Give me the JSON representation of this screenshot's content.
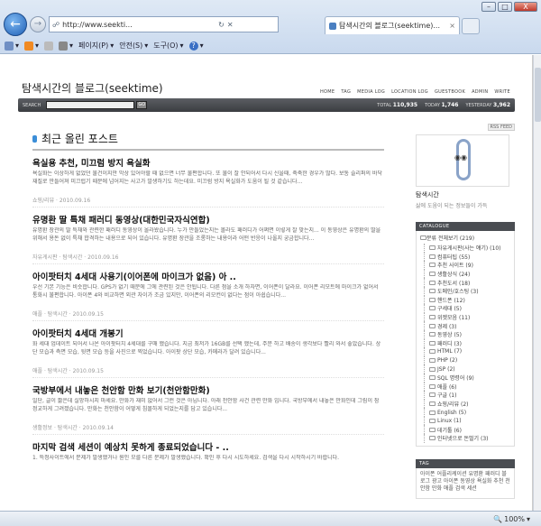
{
  "browser": {
    "address": "http://www.seekti...",
    "tab_title": "탐색시간의 블로그(seektime)...",
    "toolbar": {
      "page_label": "페이지(P)",
      "safety_label": "안전(S)",
      "tools_label": "도구(O)",
      "help_label": "?"
    },
    "window_buttons": {
      "minimize": "–",
      "restore": "□",
      "close": "X"
    },
    "zoom": "100%"
  },
  "blog": {
    "title": "탐색시간의 블로그(seektime)",
    "nav": [
      "HOME",
      "TAG",
      "MEDIA LOG",
      "LOCATION LOG",
      "GUESTBOOK",
      "ADMIN",
      "WRITE"
    ],
    "search_label": "SEARCH",
    "search_button": "GO",
    "stats": {
      "total_label": "TOTAL",
      "total": "110,935",
      "today_label": "TODAY",
      "today": "1,746",
      "yesterday_label": "YESTERDAY",
      "yesterday": "3,962"
    }
  },
  "main": {
    "heading": "최근 올린 포스트",
    "posts": [
      {
        "title": "욕실용 추천, 미끄럼 방지 욕실화",
        "body": "욕실화는 이상하게 없었던 물건이지만 막상 있어야할 때 없으면 너무 불편합니다. 또 불이 잘 안되어서 다시 신을때, 축축한 경우가 많다. 보통 슬리퍼의 바닥 재질로 만들어져 미끄럽기 때문에 넘어지는 사고가 발생하기도 하는데요. 미끄럼 방지 욕실화가 도움이 될 것 같습니다...",
        "meta": "쇼핑/리뷰 · 2010.09.16"
      },
      {
        "title": "유명환 딸 특채 패러디 동영상(대한민국자식연합)",
        "body": "유명환 장관의 딸 특채와 관련한 패러디 동영상이 올라왔습니다. 누가 만들었는지는 몰라도 패러디가 어쩌면 이렇게 잘 맞는지... 이 동영상은 유명환의 딸을 위해서 용돈 없이 특채 합격하는 내용으로 되어 있습니다. 유명환 장관을 조롱하는 내용이라 어떤 반응이 나올지 궁금합니다...",
        "meta": "자유게시판 · 탐색시간 · 2010.09.16"
      },
      {
        "title": "아이팟터치 4세대 사용기(이어폰에 마이크가 없음) 아 ..",
        "body": "우선 기본 기능은 비슷합니다. GPS가 없기 때문에 그에 관련된 것은 안됩니다. 다른 점을 소개 하자면, 이어폰이 달라요. 이어폰 리모트에 마이크가 없어서 통화시 불편합니다. 아이폰 4와 비교하면 외관 차이가 조금 있지만, 이어폰의 리모컨이 없다는 점이 아쉽습니다...",
        "meta": "애플 · 탐색시간 · 2010.09.15"
      },
      {
        "title": "아이팟터치 4세대 개봉기",
        "body": "화 세대 업데이트 되어서 나온 아이팟터치 4세대를 구매 했습니다. 지금 최저가 16GB를 선택 했는데, 주문 하고 배송이 생각보다 빨리 와서 좋았습니다. 상단 모습과 측면 모습, 뒷면 모습 등을 사진으로 찍었습니다. 아이팟 상단 모습, 카메라가 달려 있습니다...",
        "meta": "애플 · 탐색시간 · 2010.09.15"
      },
      {
        "title": "국방부에서 내놓은 천안함 만화 보기(천안함만화)",
        "body": "일단, 글이 짧은데 실망하시지 마세요. 만화가 재미 없어서 그런 것은 아닙니다. 아래 천안함 사건 관련 만화 입니다. 국방부에서 내놓은 만화인데 그림이 참 정교하게 그려졌습니다. 만화는 천안함이 어떻게 침몰하게 되었는지를 담고 있습니다...",
        "meta": "생활정보 · 탐색시간 · 2010.09.14"
      },
      {
        "title": "마지막 검색 세션이 예상치 못하게 종료되었습니다 - ..",
        "body": "1. 특정사이트에서 문제가 발생했거나 원인 모를 다른 문제가 발생했습니다. 확인 후 다시 시도하세요. 검색을 다시 시작하시기 바랍니다.",
        "meta": ""
      }
    ]
  },
  "sidebar": {
    "rss": "RSS FEED",
    "profile_name": "탐색시간",
    "profile_desc": "삶에 도움이 되는 정보들이 가득",
    "catalogue_head": "CATALOGUE",
    "categories": [
      {
        "label": "분류 전체보기 (219)"
      },
      {
        "label": "자유게시판(사는 얘기) (10)"
      },
      {
        "label": "컴퓨터팁 (55)"
      },
      {
        "label": "추천 사이트 (9)"
      },
      {
        "label": "생활상식 (24)"
      },
      {
        "label": "추천도서 (18)"
      },
      {
        "label": "도메인/호스팅 (3)"
      },
      {
        "label": "핸드폰 (12)"
      },
      {
        "label": "구세대 (5)"
      },
      {
        "label": "위젯모음 (11)"
      },
      {
        "label": "경제 (3)"
      },
      {
        "label": "동영상 (5)"
      },
      {
        "label": "패러디 (3)"
      },
      {
        "label": "HTML (7)"
      },
      {
        "label": "PHP (2)"
      },
      {
        "label": "JSP (2)"
      },
      {
        "label": "SQL 명령어 (9)"
      },
      {
        "label": "애플 (6)"
      },
      {
        "label": "구글 (1)"
      },
      {
        "label": "쇼핑/리뷰 (2)"
      },
      {
        "label": "English (5)"
      },
      {
        "label": "Linux (1)"
      },
      {
        "label": "데기툴 (6)"
      },
      {
        "label": "인터넷으로 돈벌기 (3)"
      }
    ],
    "tag_head": "TAG",
    "tags": "아이폰 어플리케이션 유명환 패러디 블로그 광고 아이폰 동영상 욕실화 추천 천안함 만화 애플 검색 세션"
  }
}
